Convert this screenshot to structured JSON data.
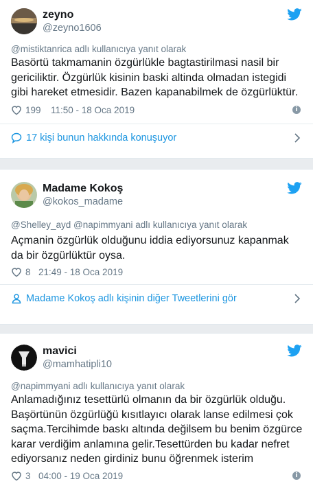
{
  "colors": {
    "accent": "#1b95e0",
    "muted": "#657786",
    "text": "#14171a",
    "background": "#e9ecef"
  },
  "tweets": [
    {
      "name": "zeyno",
      "handle": "@zeyno1606",
      "reply_to": "@mistiktanrica adlı kullanıcıya yanıt olarak",
      "lines": [
        "Basörtü takmamanin özgürlükle bagtastirilmasi nasil bir",
        "gericiliktir. Özgürlük kisinin baski altinda olmadan istegidi",
        "gibi hareket etmesidir. Bazen kapanabilmek de özgürlüktür."
      ],
      "likes": "199",
      "timestamp": "11:50 - 18 Oca 2019",
      "footer_link": "17 kişi bunun hakkında konuşuyor",
      "footer_icon": "speech-bubble-icon"
    },
    {
      "name": "Madame Kokoş",
      "handle": "@kokos_madame",
      "reply_to": "@Shelley_ayd @napimmyani adlı kullanıcıya yanıt olarak",
      "lines": [
        "Açmanin özgürlük olduğunu iddia ediyorsunuz kapanmak",
        "da bir özgürlüktür oysa."
      ],
      "likes": "8",
      "timestamp": "21:49 - 18 Oca 2019",
      "footer_link": "Madame Kokoş adlı kişinin diğer Tweetlerini gör",
      "footer_icon": "person-icon"
    },
    {
      "name": "mavici",
      "handle": "@mamhatipli10",
      "reply_to": "@napimmyani adlı kullanıcıya yanıt olarak",
      "lines": [
        "Anlamadığınız tesettürlü olmanın da bir özgürlük olduğu.",
        "Başörtünün özgürlüğü kısıtlayıcı olarak lanse edilmesi çok",
        "saçma.Tercihimde baskı altında değilsem bu benim özgürce",
        "karar verdiğim anlamına gelir.Tesettürden bu kadar nefret",
        "ediyorsanız neden girdiniz bunu  öğrenmek isterim"
      ],
      "likes": "3",
      "timestamp": "04:00 - 19 Oca 2019"
    }
  ]
}
